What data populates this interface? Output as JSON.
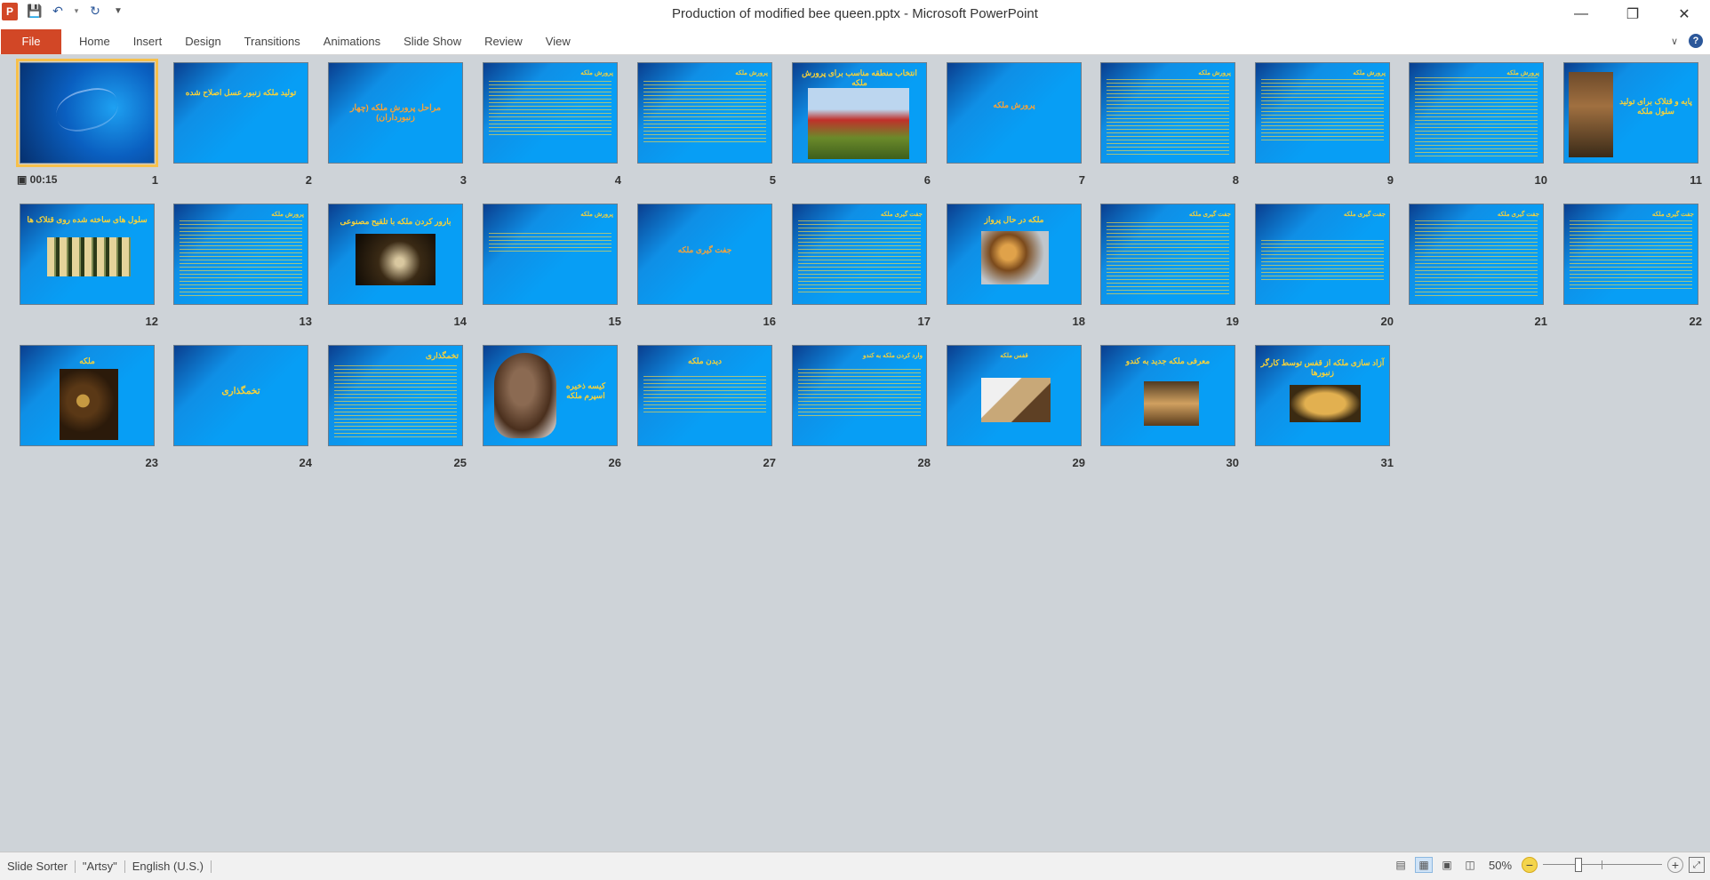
{
  "window": {
    "title": "Production of modified bee queen.pptx  -  Microsoft PowerPoint",
    "app_icon": "P",
    "controls": [
      "minimize-icon",
      "restore-icon",
      "close-icon"
    ]
  },
  "ribbon": {
    "file_label": "File",
    "tabs": [
      "Home",
      "Insert",
      "Design",
      "Transitions",
      "Animations",
      "Slide Show",
      "Review",
      "View"
    ]
  },
  "slides": [
    {
      "number": "1",
      "timing": "00:15",
      "title": ""
    },
    {
      "number": "2",
      "title": "تولید ملکه زنبور عسل اصلاح شده"
    },
    {
      "number": "3",
      "title": "مراحل پرورش ملکه (چهار زنبورداران)"
    },
    {
      "number": "4",
      "title": "پرورش ملکه"
    },
    {
      "number": "5",
      "title": "پرورش ملکه"
    },
    {
      "number": "6",
      "title": "انتخاب منطقه مناسب برای پرورش ملکه"
    },
    {
      "number": "7",
      "title": "پرورش ملکه"
    },
    {
      "number": "8",
      "title": "پرورش ملکه"
    },
    {
      "number": "9",
      "title": "پرورش ملکه"
    },
    {
      "number": "10",
      "title": "پرورش ملکه"
    },
    {
      "number": "11",
      "title": "پایه و قتلاک برای تولید سلول ملکه"
    },
    {
      "number": "12",
      "title": "سلول های ساخته شده روی قتلاک ها"
    },
    {
      "number": "13",
      "title": "پرورش ملکه"
    },
    {
      "number": "14",
      "title": "بارور کردن ملکه با تلقیح مصنوعی"
    },
    {
      "number": "15",
      "title": "پرورش ملکه"
    },
    {
      "number": "16",
      "title": "جفت گیری ملکه"
    },
    {
      "number": "17",
      "title": "جفت گیری ملکه"
    },
    {
      "number": "18",
      "title": "ملکه در حال پرواز"
    },
    {
      "number": "19",
      "title": "جفت گیری ملکه"
    },
    {
      "number": "20",
      "title": "جفت گیری ملکه"
    },
    {
      "number": "21",
      "title": "جفت گیری ملکه"
    },
    {
      "number": "22",
      "title": "جفت گیری ملکه"
    },
    {
      "number": "23",
      "title": "ملکه"
    },
    {
      "number": "24",
      "title": "تخمگذاری"
    },
    {
      "number": "25",
      "title": "تخمگذاری"
    },
    {
      "number": "26",
      "title": "کیسه ذخیره اسپرم ملکه"
    },
    {
      "number": "27",
      "title": "دیدن ملکه"
    },
    {
      "number": "28",
      "title": "وارد کردن ملکه به کندو"
    },
    {
      "number": "29",
      "title": "قفس ملکه"
    },
    {
      "number": "30",
      "title": "معرفی ملکه جدید به کندو"
    },
    {
      "number": "31",
      "title": "آزاد سازی ملکه از قفس توسط کارگر زنبورها"
    }
  ],
  "statusbar": {
    "view": "Slide Sorter",
    "theme": "\"Artsy\"",
    "language": "English (U.S.)",
    "zoom": "50%",
    "zoom_fraction": 0.5
  },
  "colors": {
    "accent": "#d24726",
    "slide_bg": "#079ef5",
    "slide_text": "#f7d23a",
    "selection": "#f7c04a"
  }
}
